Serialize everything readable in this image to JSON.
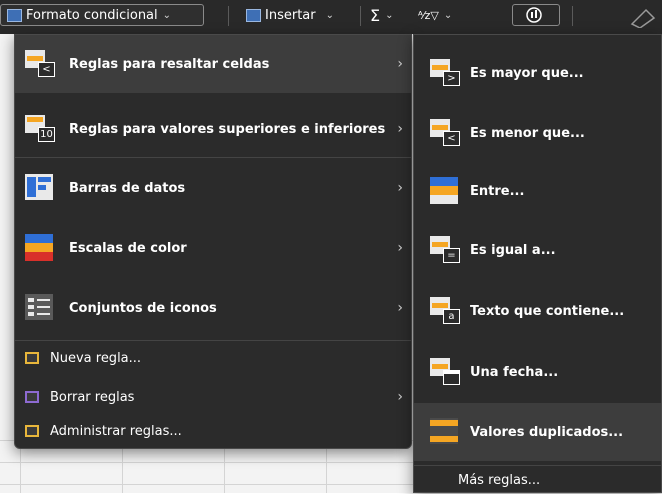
{
  "ribbon": {
    "conditional_format": "Formato condicional",
    "insert": "Insertar",
    "sum_glyph": "Σ",
    "sort_glyph": "ᴬ⁄ᴢ▽",
    "chevron": "⌄"
  },
  "main_menu": {
    "items": [
      {
        "label": "Reglas para resaltar celdas",
        "icon": "highlight-cells-icon"
      },
      {
        "label": "Reglas para valores superiores e inferiores",
        "icon": "top-bottom-icon",
        "icon_text": "10"
      },
      {
        "label": "Barras de datos",
        "icon": "data-bars-icon"
      },
      {
        "label": "Escalas de color",
        "icon": "color-scales-icon"
      },
      {
        "label": "Conjuntos de iconos",
        "icon": "icon-sets-icon"
      }
    ],
    "small_items": [
      {
        "label": "Nueva regla...",
        "icon": "new-rule-icon"
      },
      {
        "label": "Borrar reglas",
        "icon": "clear-rules-icon"
      },
      {
        "label": "Administrar reglas...",
        "icon": "manage-rules-icon"
      }
    ],
    "arrow": "›"
  },
  "sub_menu": {
    "items": [
      {
        "label": "Es mayor que...",
        "icon": "greater-than-icon",
        "icon_text": ">"
      },
      {
        "label": "Es menor que...",
        "icon": "less-than-icon",
        "icon_text": "<"
      },
      {
        "label": "Entre...",
        "icon": "between-icon"
      },
      {
        "label": "Es igual a...",
        "icon": "equal-to-icon",
        "icon_text": "="
      },
      {
        "label": "Texto que contiene...",
        "icon": "text-contains-icon",
        "icon_text": "a"
      },
      {
        "label": "Una fecha...",
        "icon": "date-occurring-icon"
      },
      {
        "label": "Valores duplicados...",
        "icon": "duplicate-values-icon"
      }
    ],
    "more_rules": "Más reglas..."
  },
  "colors": {
    "menu_bg": "#2b2b2b",
    "highlight_bg": "#3d3d3d",
    "accent_orange": "#f5a623",
    "accent_blue": "#2f6fd6",
    "accent_red": "#d9302a"
  }
}
